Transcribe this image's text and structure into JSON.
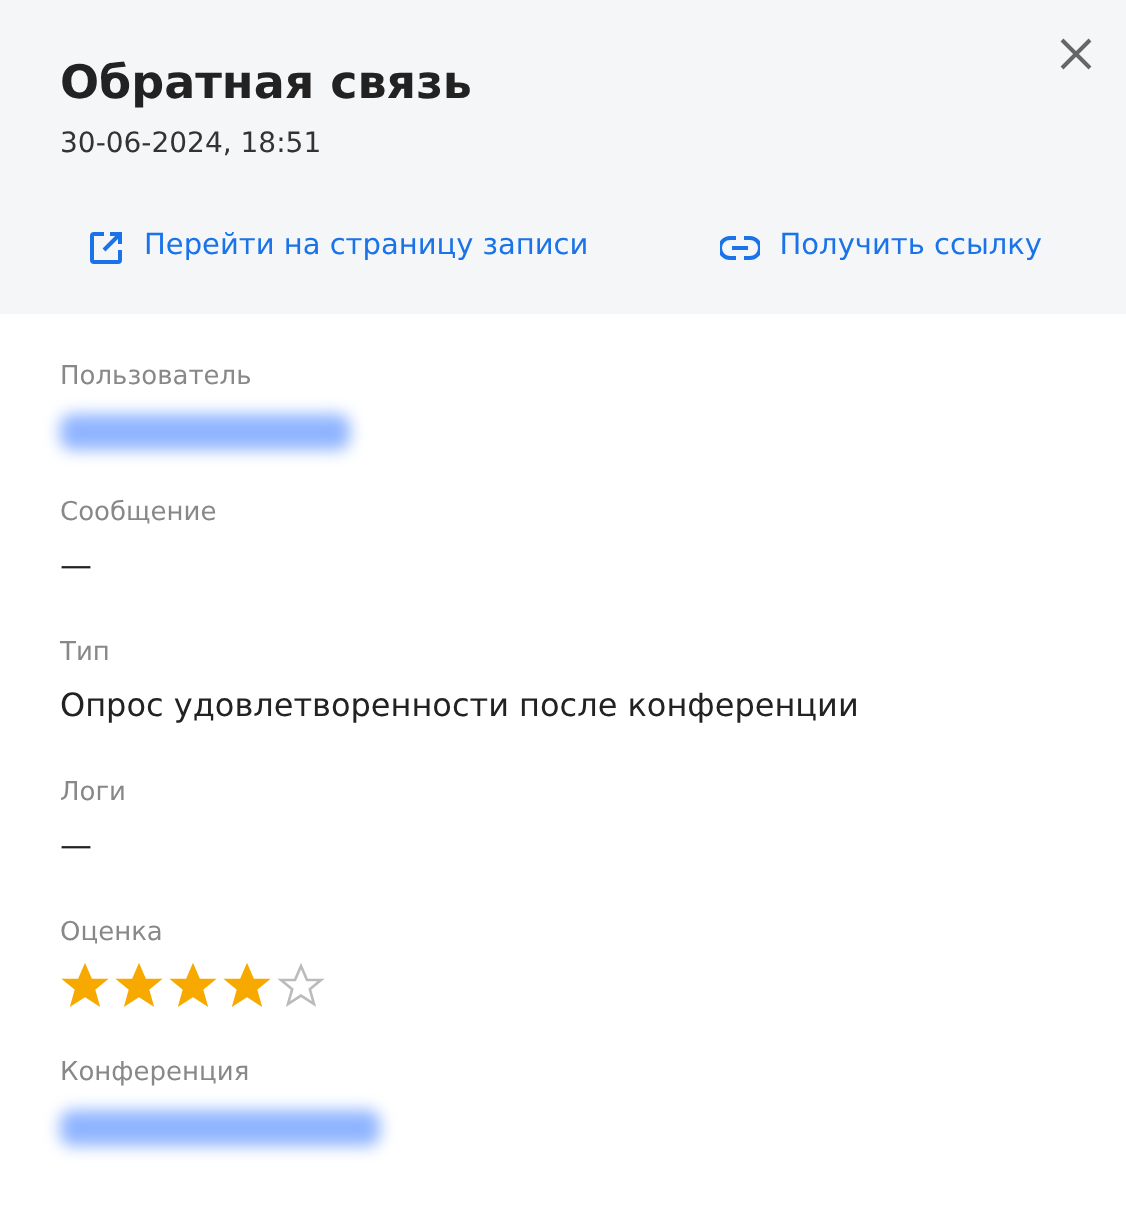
{
  "header": {
    "title": "Обратная связь",
    "date": "30-06-2024, 18:51",
    "actions": [
      {
        "kind": "external",
        "label": "Перейти на страницу записи"
      },
      {
        "kind": "link",
        "label": "Получить ссылку"
      }
    ]
  },
  "fields": [
    {
      "label": "Пользователь",
      "kind": "redacted"
    },
    {
      "label": "Сообщение",
      "kind": "text",
      "value": "—"
    },
    {
      "label": "Тип",
      "kind": "text",
      "value": "Опрос удовлетворенности после конференции"
    },
    {
      "label": "Логи",
      "kind": "text",
      "value": "—"
    },
    {
      "label": "Оценка",
      "kind": "stars",
      "stars": 4
    },
    {
      "label": "Конференция",
      "kind": "redacted"
    }
  ]
}
